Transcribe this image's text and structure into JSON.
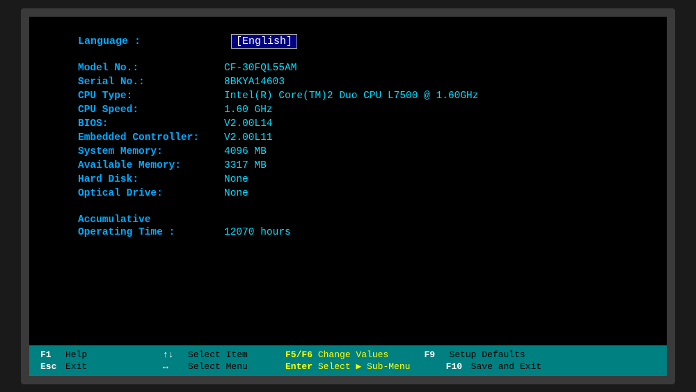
{
  "bios": {
    "language_label": "Language :",
    "language_value": "[English]",
    "fields": [
      {
        "label": "Model No.:",
        "value": "CF-30FQL55AM"
      },
      {
        "label": "Serial No.:",
        "value": "8BKYA14603"
      },
      {
        "label": "CPU Type:",
        "value": "Intel(R) Core(TM)2 Duo CPU L7500 @ 1.60GHz"
      },
      {
        "label": "CPU Speed:",
        "value": "1.60 GHz"
      },
      {
        "label": "BIOS:",
        "value": "V2.00L14"
      },
      {
        "label": "Embedded Controller:",
        "value": "V2.00L11"
      },
      {
        "label": "System Memory:",
        "value": "4096 MB"
      },
      {
        "label": "Available Memory:",
        "value": "3317 MB"
      },
      {
        "label": "Hard Disk:",
        "value": "None"
      },
      {
        "label": "Optical Drive:",
        "value": "None"
      }
    ],
    "accumulative_title": "Accumulative",
    "operating_label": "Operating Time :",
    "operating_value": "12070  hours"
  },
  "bottom_bar": {
    "row1": [
      {
        "key": "F1",
        "desc": "Help",
        "yellow": false
      },
      {
        "key": "↑↓",
        "desc": "Select Item",
        "yellow": false
      },
      {
        "key": "F5/F6",
        "desc": "Change Values",
        "yellow": true
      },
      {
        "key": "F9",
        "desc": "Setup Defaults",
        "yellow": false
      }
    ],
    "row2": [
      {
        "key": "Esc",
        "desc": "Exit",
        "yellow": false
      },
      {
        "key": "↔",
        "desc": "Select Menu",
        "yellow": false
      },
      {
        "key": "Enter",
        "desc": "Select ▶ Sub-Menu",
        "yellow": true
      },
      {
        "key": "F10",
        "desc": "Save and Exit",
        "yellow": false
      }
    ]
  }
}
